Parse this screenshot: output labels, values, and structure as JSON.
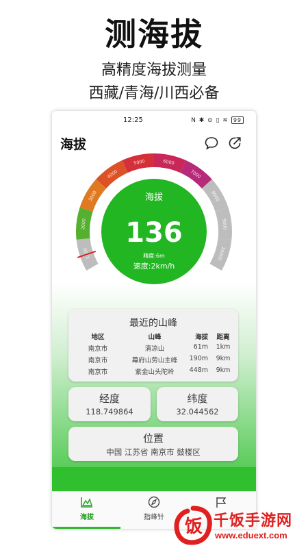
{
  "promo": {
    "title": "测海拔",
    "subtitle_1": "高精度海拔测量",
    "subtitle_2": "西藏/青海/川西必备"
  },
  "status_bar": {
    "time": "12:25",
    "icons": "N ✱ ⊙ ▯ ≋",
    "battery": "99"
  },
  "header": {
    "title": "海拔",
    "icons": [
      "chat-icon",
      "share-icon"
    ]
  },
  "gauge": {
    "title": "海拔",
    "altitude": "136",
    "accuracy": "精度:6m",
    "speed": "速度:2km/h",
    "scale_labels": [
      "1000",
      "2000",
      "3000",
      "4000",
      "5000",
      "6000",
      "7000",
      "8000",
      "9000",
      "10000"
    ],
    "altitude_max": 10000,
    "colors": {
      "center_fill": "#22b622",
      "center_ring": "#ffffff",
      "needle": "#e02020",
      "inactive": "#bdbdbd"
    }
  },
  "nearby_peaks": {
    "title": "最近的山峰",
    "headers": [
      "地区",
      "山峰",
      "海拔",
      "距离"
    ],
    "rows": [
      [
        "南京市",
        "清凉山",
        "61m",
        "1km"
      ],
      [
        "南京市",
        "幕府山劳山主峰",
        "190m",
        "9km"
      ],
      [
        "南京市",
        "紫金山头陀岭",
        "448m",
        "9km"
      ]
    ]
  },
  "longitude": {
    "label": "经度",
    "value": "118.749864"
  },
  "latitude": {
    "label": "纬度",
    "value": "32.044562"
  },
  "location": {
    "label": "位置",
    "value": "中国 江苏省 南京市 鼓楼区"
  },
  "tabs": [
    {
      "label": "海拔",
      "icon": "altitude-chart-icon",
      "active": true
    },
    {
      "label": "指峰针",
      "icon": "compass-icon",
      "active": false
    },
    {
      "label": "",
      "icon": "flag-icon",
      "active": false
    }
  ],
  "watermark": {
    "text": "千饭手游网",
    "url": "www.eduext.com",
    "logo_char": "饭"
  },
  "theme": {
    "accent": "#2fb82f",
    "active_tab": "#1f9e1f"
  }
}
